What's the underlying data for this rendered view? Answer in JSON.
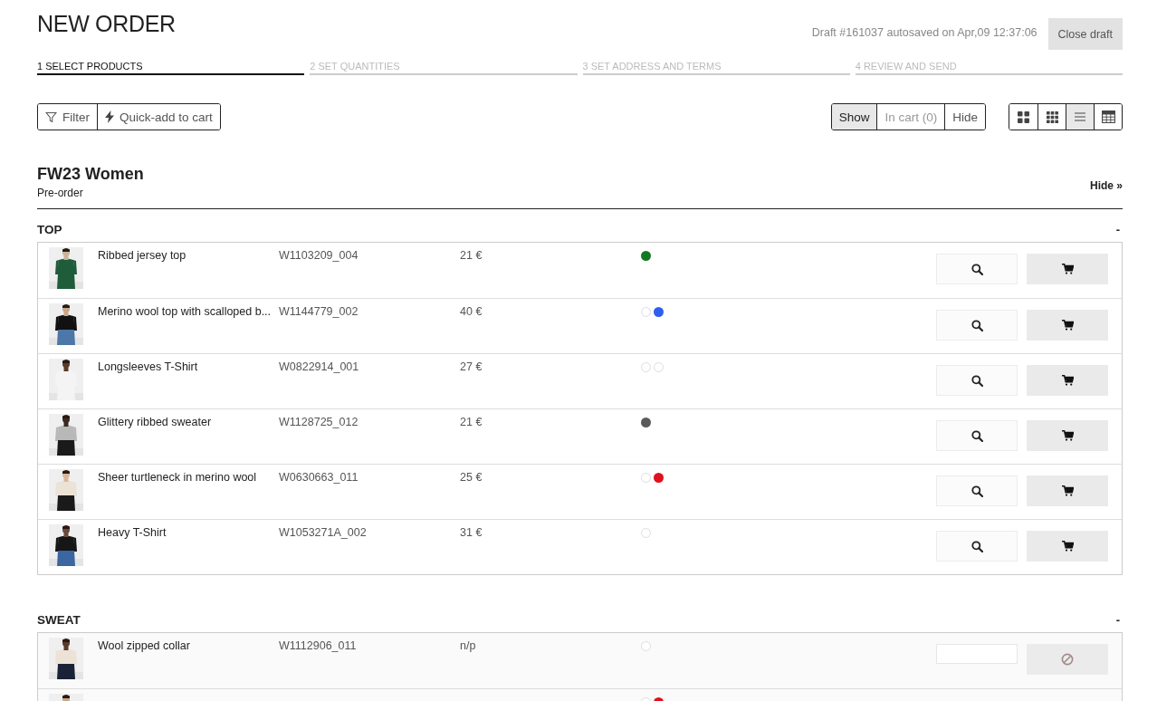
{
  "title": "NEW ORDER",
  "draft_status": "Draft #161037 autosaved on Apr,09 12:37:06",
  "close_button": "Close draft",
  "steps": [
    {
      "label": "1 SELECT PRODUCTS",
      "selected": true
    },
    {
      "label": "2 SET QUANTITIES",
      "selected": false
    },
    {
      "label": "3 SET ADDRESS AND TERMS",
      "selected": false
    },
    {
      "label": "4 REVIEW AND SEND",
      "selected": false
    }
  ],
  "tools": [
    {
      "kind": "filter",
      "label": "Filter"
    },
    {
      "kind": "quick-add",
      "label": "Quick-add to cart"
    }
  ],
  "show_filter": [
    {
      "label": "Show",
      "selected": true,
      "disabled": false
    },
    {
      "label": "In cart (0)",
      "selected": false,
      "disabled": true
    },
    {
      "label": "Hide",
      "selected": false,
      "disabled": false
    }
  ],
  "view_modes": [
    {
      "kind": "large-grid",
      "selected": false
    },
    {
      "kind": "small-grid",
      "selected": false
    },
    {
      "kind": "list",
      "selected": true
    },
    {
      "kind": "table",
      "selected": false
    }
  ],
  "collection": {
    "title": "FW23 Women",
    "subtitle": "Pre-order",
    "hide_link": "Hide »"
  },
  "categories": [
    {
      "name": "TOP",
      "toggle": "-",
      "products": [
        {
          "kind": "available",
          "name": "Ribbed jersey top",
          "sku": "W1103209_004",
          "price": "21 €",
          "swatches": [
            {
              "color": "#137a23"
            }
          ]
        },
        {
          "kind": "available",
          "name": "Merino wool top with scalloped b...",
          "sku": "W1144779_002",
          "price": "40 €",
          "swatches": [
            {
              "color": "#ffffff"
            },
            {
              "color": "#2f5ff0"
            }
          ]
        },
        {
          "kind": "available",
          "name": "Longsleeves T-Shirt",
          "sku": "W0822914_001",
          "price": "27 €",
          "swatches": [
            {
              "color": "#ffffff"
            },
            {
              "color": "#ffffff"
            }
          ]
        },
        {
          "kind": "available",
          "name": "Glittery ribbed sweater",
          "sku": "W1128725_012",
          "price": "21 €",
          "swatches": [
            {
              "color": "#5a5a5a"
            }
          ]
        },
        {
          "kind": "available",
          "name": "Sheer turtleneck in merino wool",
          "sku": "W0630663_011",
          "price": "25 €",
          "swatches": [
            {
              "color": "#ffffff"
            },
            {
              "color": "#e0101e"
            }
          ]
        },
        {
          "kind": "available",
          "name": "Heavy T-Shirt",
          "sku": "W1053271A_002",
          "price": "31 €",
          "swatches": [
            {
              "color": "#ffffff"
            }
          ]
        }
      ]
    },
    {
      "name": "SWEAT",
      "toggle": "-",
      "products": [
        {
          "kind": "unavailable",
          "name": "Wool zipped collar",
          "sku": "W1112906_011",
          "price": "n/p",
          "swatches": [
            {
              "color": "#ffffff"
            }
          ]
        },
        {
          "kind": "clipped",
          "swatches": [
            {
              "color": "#ffffff"
            },
            {
              "color": "#e0101e"
            }
          ]
        }
      ]
    }
  ]
}
